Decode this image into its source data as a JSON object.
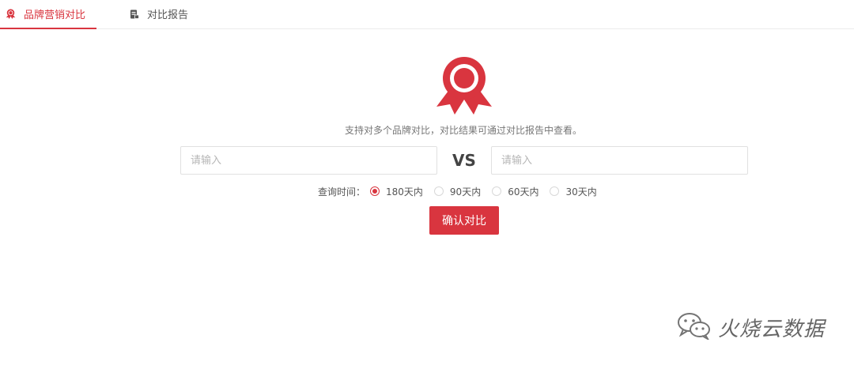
{
  "tabs": [
    {
      "label": "品牌营销对比",
      "icon": "ribbon-badge-icon",
      "active": true
    },
    {
      "label": "对比报告",
      "icon": "report-icon",
      "active": false
    }
  ],
  "main": {
    "description": "支持对多个品牌对比，对比结果可通过对比报告中查看。",
    "input_left_placeholder": "请输入",
    "input_right_placeholder": "请输入",
    "vs_label": "VS",
    "time_label": "查询时间：",
    "time_options": [
      {
        "label": "180天内",
        "checked": true
      },
      {
        "label": "90天内",
        "checked": false
      },
      {
        "label": "60天内",
        "checked": false
      },
      {
        "label": "30天内",
        "checked": false
      }
    ],
    "confirm_label": "确认对比"
  },
  "watermark": {
    "text": "火烧云数据",
    "icon": "wechat-icon"
  },
  "colors": {
    "accent": "#d9353f",
    "text": "#555555",
    "border": "#e1e1e1"
  }
}
